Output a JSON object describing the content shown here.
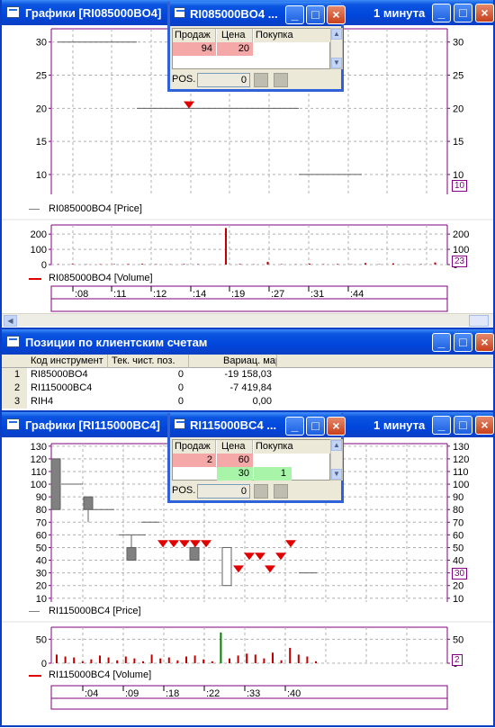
{
  "colors": {
    "title_bar": "#0a3fc4",
    "axis": "#800080",
    "sell_bg": "#f4a8a8",
    "buy_bg": "#a8f4a8",
    "signal_red": "#e00000",
    "volume_red": "#c00000",
    "volume_green": "#008000"
  },
  "chart1": {
    "title": "Графики [RI085000BO4]",
    "interval": "1 минута",
    "price_legend": "RI085000BO4 [Price]",
    "volume_legend": "RI085000BO4 [Volume]",
    "price_box": "10",
    "volume_box": "23",
    "time_labels": [
      ":08",
      ":11",
      ":12",
      ":14",
      ":19",
      ":27",
      ":31",
      ":44"
    ]
  },
  "popup1": {
    "title": "RI085000BO4 ...",
    "headers": [
      "Продаж",
      "Цена",
      "Покупка"
    ],
    "rows": [
      {
        "sell": "94",
        "price": "20",
        "buy": ""
      }
    ],
    "pos_label": "POS.",
    "pos_value": "0"
  },
  "positions": {
    "title": "Позиции по клиентским счетам",
    "headers": [
      "Код инструмент",
      "Тек. чист. поз.",
      "Вариац. маржа"
    ],
    "rows": [
      {
        "n": "1",
        "code": "RI85000BO4",
        "pos": "0",
        "margin": "-19 158,03"
      },
      {
        "n": "2",
        "code": "RI115000BC4",
        "pos": "0",
        "margin": "-7 419,84"
      },
      {
        "n": "3",
        "code": "RIH4",
        "pos": "0",
        "margin": "0,00"
      }
    ]
  },
  "chart2": {
    "title": "Графики [RI115000BC4]",
    "interval": "1 минута",
    "price_legend": "RI115000BC4 [Price]",
    "volume_legend": "RI115000BC4 [Volume]",
    "price_box": "30",
    "volume_box": "2",
    "time_labels": [
      ":04",
      ":09",
      ":18",
      ":22",
      ":33",
      ":40"
    ]
  },
  "popup2": {
    "title": "RI115000BC4 ...",
    "headers": [
      "Продаж",
      "Цена",
      "Покупка"
    ],
    "rows": [
      {
        "sell": "2",
        "price": "60",
        "buy": ""
      },
      {
        "sell": "",
        "price": "30",
        "buy": "1"
      }
    ],
    "pos_label": "POS.",
    "pos_value": "0"
  },
  "chart_data": [
    {
      "type": "candlestick",
      "instrument": "RI085000BO4",
      "ylim": [
        7,
        32
      ],
      "y_ticks": [
        10,
        15,
        20,
        25,
        30
      ],
      "sell_signal_markers": [
        {
          "x": ":14",
          "y": 20.5
        }
      ],
      "flat_price_levels": [
        {
          "x_range": [
            ":08",
            ":14"
          ],
          "y": 30
        },
        {
          "x_range": [
            ":14",
            ":27"
          ],
          "y": 20
        },
        {
          "x_range": [
            ":27",
            ":44"
          ],
          "y": 10
        }
      ],
      "volume": {
        "ylim": [
          0,
          260
        ],
        "y_ticks": [
          0,
          100,
          200
        ],
        "bars": [
          3,
          4,
          2,
          3,
          3,
          4,
          5,
          3,
          2,
          4,
          3,
          2,
          240,
          4,
          2,
          18,
          3,
          2,
          6,
          3,
          4,
          2,
          10,
          3,
          8,
          2,
          3,
          14
        ]
      }
    },
    {
      "type": "candlestick",
      "instrument": "RI115000BC4",
      "ylim": [
        7,
        132
      ],
      "y_ticks": [
        10,
        20,
        30,
        40,
        50,
        60,
        70,
        80,
        90,
        100,
        110,
        120,
        130
      ],
      "candles": [
        {
          "open": 120,
          "close": 80,
          "high": 120,
          "low": 80
        },
        {
          "open": 90,
          "close": 80,
          "high": 90,
          "low": 70
        },
        {
          "open": 50,
          "close": 40,
          "high": 60,
          "low": 40
        },
        {
          "open": 50,
          "close": 40,
          "high": 55,
          "low": 40
        },
        {
          "open": 50,
          "close": 20,
          "high": 50,
          "low": 20
        }
      ],
      "sell_signal_markers": [
        {
          "y": 53
        },
        {
          "y": 53
        },
        {
          "y": 53
        },
        {
          "y": 53
        },
        {
          "y": 53
        },
        {
          "y": 33
        },
        {
          "y": 43
        },
        {
          "y": 43
        },
        {
          "y": 33
        },
        {
          "y": 43
        },
        {
          "y": 53
        }
      ],
      "volume": {
        "ylim": [
          0,
          75
        ],
        "y_ticks": [
          0,
          50
        ],
        "bars": [
          18,
          14,
          12,
          4,
          8,
          16,
          12,
          6,
          14,
          10,
          4,
          18,
          10,
          12,
          6,
          14,
          16,
          8,
          4,
          64,
          10,
          16,
          20,
          18,
          10,
          22,
          6,
          32,
          18,
          14,
          4
        ]
      }
    }
  ]
}
